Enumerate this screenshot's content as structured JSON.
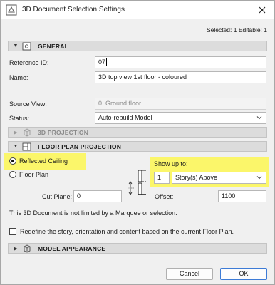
{
  "window": {
    "title": "3D Document Selection Settings",
    "close_icon": "close-icon"
  },
  "summary": "Selected: 1 Editable: 1",
  "general": {
    "title": "GENERAL",
    "reference_id_label": "Reference ID:",
    "reference_id_value": "07",
    "name_label": "Name:",
    "name_value": "3D top view 1st floor - coloured",
    "source_view_label": "Source View:",
    "source_view_value": "0. Ground floor",
    "status_label": "Status:",
    "status_value": "Auto-rebuild Model"
  },
  "projection": {
    "title": "3D PROJECTION"
  },
  "floor_plan": {
    "title": "FLOOR PLAN PROJECTION",
    "reflected_ceiling_label": "Reflected Ceiling",
    "floor_plan_label": "Floor Plan",
    "selected_option": "Reflected Ceiling",
    "show_up_to_label": "Show up to:",
    "show_up_to_number": "1",
    "show_up_to_unit": "Story(s) Above",
    "cut_plane_label": "Cut Plane:",
    "cut_plane_value": "0",
    "offset_label": "Offset:",
    "offset_value": "1100"
  },
  "marquee_message": "This 3D Document is not limited by a Marquee or selection.",
  "redefine_label": "Redefine the story, orientation and content based on the current Floor Plan.",
  "model_appearance": {
    "title": "MODEL APPEARANCE"
  },
  "buttons": {
    "cancel": "Cancel",
    "ok": "OK"
  },
  "colors": {
    "highlight": "#fbf66a",
    "primary_border": "#3d7bd6"
  }
}
